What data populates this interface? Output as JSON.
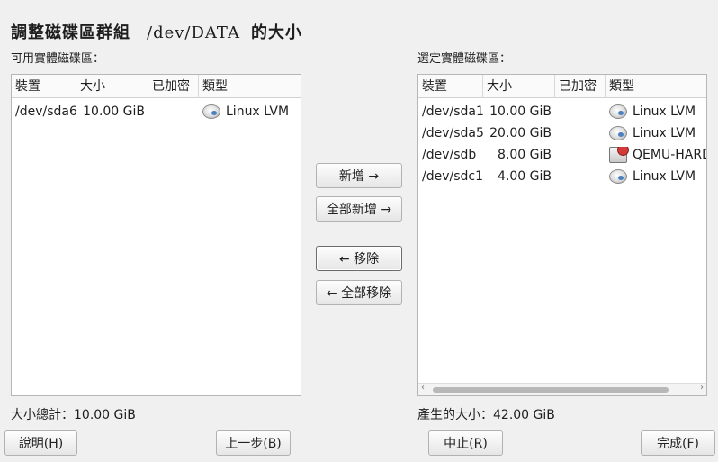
{
  "dialog": {
    "title_prefix": "調整磁碟區群組",
    "title_path": "/dev/DATA",
    "title_suffix": "的大小"
  },
  "available": {
    "label": "可用實體磁碟區：",
    "columns": [
      "裝置",
      "大小",
      "已加密",
      "類型"
    ],
    "rows": [
      {
        "device": "/dev/sda6",
        "size": "10.00 GiB",
        "encrypted": "",
        "type": "Linux LVM",
        "icon": "disk-icon"
      }
    ],
    "total": "大小總計：10.00 GiB"
  },
  "selected": {
    "label": "選定實體磁碟區：",
    "columns": [
      "裝置",
      "大小",
      "已加密",
      "類型"
    ],
    "rows": [
      {
        "device": "/dev/sda1",
        "size": "10.00 GiB",
        "encrypted": "",
        "type": "Linux LVM",
        "icon": "disk-icon"
      },
      {
        "device": "/dev/sda5",
        "size": "20.00 GiB",
        "encrypted": "",
        "type": "Linux LVM",
        "icon": "disk-icon"
      },
      {
        "device": "/dev/sdb",
        "size": "8.00 GiB",
        "encrypted": "",
        "type": "QEMU-HARD",
        "icon": "hard-disk-icon"
      },
      {
        "device": "/dev/sdc1",
        "size": "4.00 GiB",
        "encrypted": "",
        "type": "Linux LVM",
        "icon": "disk-icon"
      }
    ],
    "total": "產生的大小：42.00 GiB"
  },
  "buttons": {
    "add": "新增 →",
    "add_all": "全部新增 →",
    "remove": "← 移除",
    "remove_all": "← 全部移除",
    "help": "說明(H)",
    "back": "上一步(B)",
    "abort": "中止(R)",
    "finish": "完成(F)"
  }
}
